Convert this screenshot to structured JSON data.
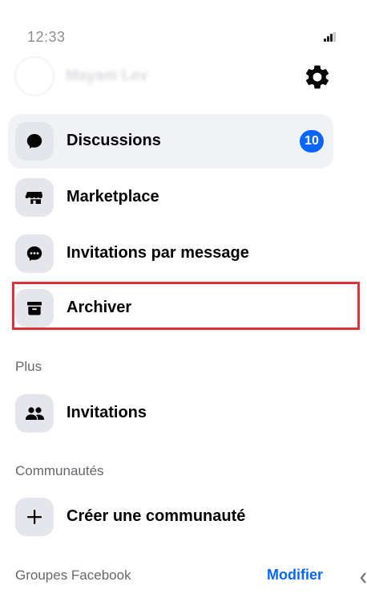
{
  "status_bar": {
    "time": "12:33"
  },
  "profile": {
    "name": "Mayam Lev",
    "blurred": true
  },
  "menu": {
    "items": [
      {
        "label": "Discussions",
        "icon": "chat-bubble-icon",
        "badge": "10",
        "active": true
      },
      {
        "label": "Marketplace",
        "icon": "storefront-icon"
      },
      {
        "label": "Invitations par message",
        "icon": "message-request-icon"
      },
      {
        "label": "Archiver",
        "icon": "archive-box-icon",
        "highlighted": true
      }
    ]
  },
  "sections": {
    "more": {
      "title": "Plus",
      "items": [
        {
          "label": "Invitations",
          "icon": "people-icon"
        }
      ]
    },
    "communities": {
      "title": "Communautés",
      "items": [
        {
          "label": "Créer une communauté",
          "icon": "plus-icon"
        }
      ]
    },
    "groups": {
      "title": "Groupes Facebook",
      "action": "Modifier"
    }
  },
  "colors": {
    "accent": "#0866ff",
    "highlight_border": "#e0313a",
    "active_row_bg": "#f0f2f5",
    "icon_bg": "#e4e6eb",
    "secondary_text": "#65676b"
  }
}
